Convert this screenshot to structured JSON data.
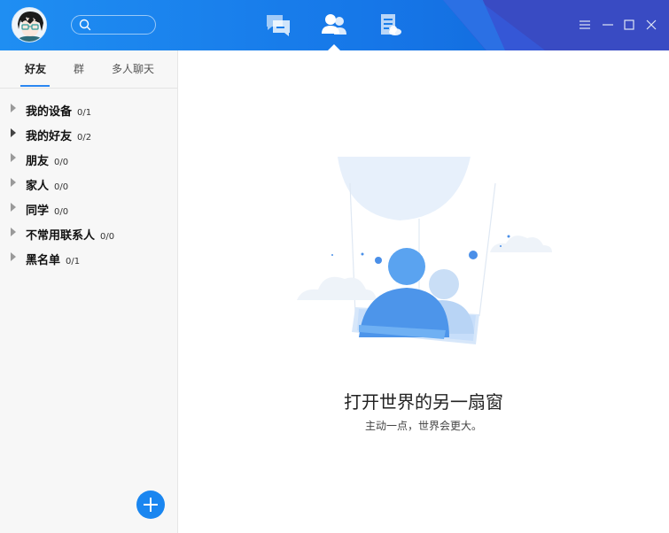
{
  "search": {
    "value": "",
    "placeholder": ""
  },
  "nav": {
    "items": [
      {
        "name": "messages",
        "icon": "chat-icon"
      },
      {
        "name": "contacts",
        "icon": "contacts-icon",
        "active": true
      },
      {
        "name": "notes",
        "icon": "notes-icon"
      }
    ]
  },
  "window_controls": [
    "menu-icon",
    "minimize-icon",
    "maximize-icon",
    "close-icon"
  ],
  "sidebar": {
    "tabs": [
      {
        "label": "好友",
        "active": true
      },
      {
        "label": "群"
      },
      {
        "label": "多人聊天"
      }
    ],
    "groups": [
      {
        "name": "我的设备",
        "count": "0/1"
      },
      {
        "name": "我的好友",
        "count": "0/2"
      },
      {
        "name": "朋友",
        "count": "0/0"
      },
      {
        "name": "家人",
        "count": "0/0"
      },
      {
        "name": "同学",
        "count": "0/0"
      },
      {
        "name": "不常用联系人",
        "count": "0/0"
      },
      {
        "name": "黑名单",
        "count": "0/1"
      }
    ]
  },
  "main": {
    "empty_title": "打开世界的另一扇窗",
    "empty_subtitle": "主动一点，世界会更大。"
  },
  "colors": {
    "accent": "#1a86f0",
    "titlebar": "#1677e8",
    "illustration_blue": "#5aa3f0"
  }
}
